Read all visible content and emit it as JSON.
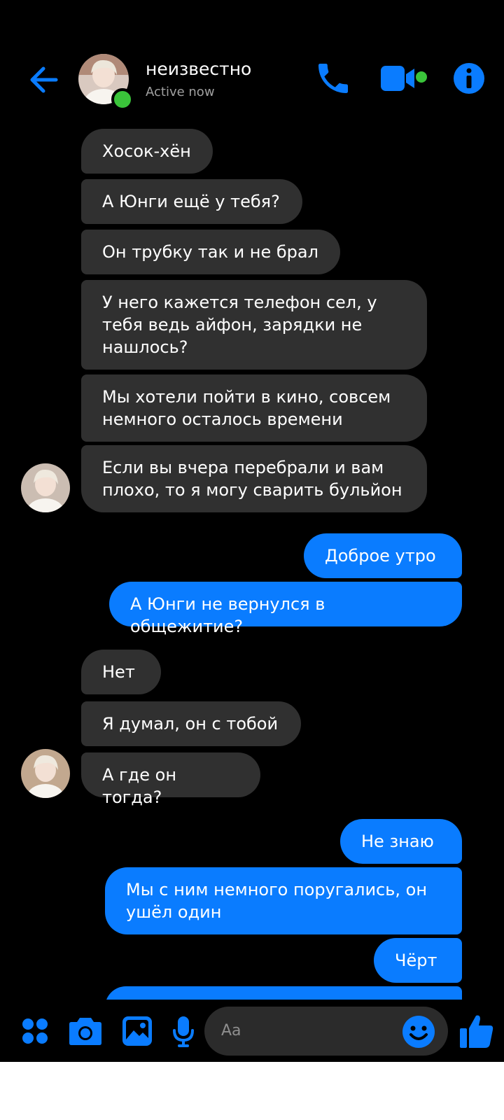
{
  "header": {
    "contact_name": "неизвестно",
    "status": "Active now",
    "icons": [
      "back-arrow-icon",
      "phone-icon",
      "video-camera-icon",
      "info-icon"
    ]
  },
  "messages": [
    {
      "direction": "incoming",
      "lines": [
        "Хосок-хён"
      ]
    },
    {
      "direction": "incoming",
      "lines": [
        "А Юнги ещё у тебя?"
      ]
    },
    {
      "direction": "incoming",
      "lines": [
        "Он трубку так и не брал"
      ]
    },
    {
      "direction": "incoming",
      "lines": [
        "У него кажется телефон сел, у",
        "тебя ведь айфон, зарядки не",
        "нашлось?"
      ]
    },
    {
      "direction": "incoming",
      "lines": [
        "Мы хотели пойти в кино, совсем",
        "немного осталось времени"
      ]
    },
    {
      "direction": "incoming",
      "lines": [
        "Если вы вчера перебрали и вам",
        "плохо, то я могу сварить бульйон"
      ]
    },
    {
      "direction": "outgoing",
      "lines": [
        "Доброе утро"
      ]
    },
    {
      "direction": "outgoing",
      "lines": [
        "А Юнги не вернулся в общежитие?"
      ]
    },
    {
      "direction": "incoming",
      "lines": [
        "Нет"
      ]
    },
    {
      "direction": "incoming",
      "lines": [
        "Я думал, он с тобой"
      ]
    },
    {
      "direction": "incoming",
      "lines": [
        "А где он тогда?"
      ]
    },
    {
      "direction": "outgoing",
      "lines": [
        "Не знаю"
      ]
    },
    {
      "direction": "outgoing",
      "lines": [
        "Мы с ним немного поругались, он",
        "ушёл один"
      ]
    },
    {
      "direction": "outgoing",
      "lines": [
        "Чёрт"
      ]
    }
  ],
  "composer": {
    "placeholder": "Aa",
    "icons": [
      "apps-icon",
      "camera-icon",
      "gallery-icon",
      "microphone-icon",
      "emoji-icon",
      "thumbs-up-icon"
    ]
  },
  "colors": {
    "background": "#000000",
    "incoming_bubble": "#303030",
    "outgoing_bubble": "#0a7cff",
    "accent": "#0a7cff",
    "online": "#3ac43a"
  }
}
